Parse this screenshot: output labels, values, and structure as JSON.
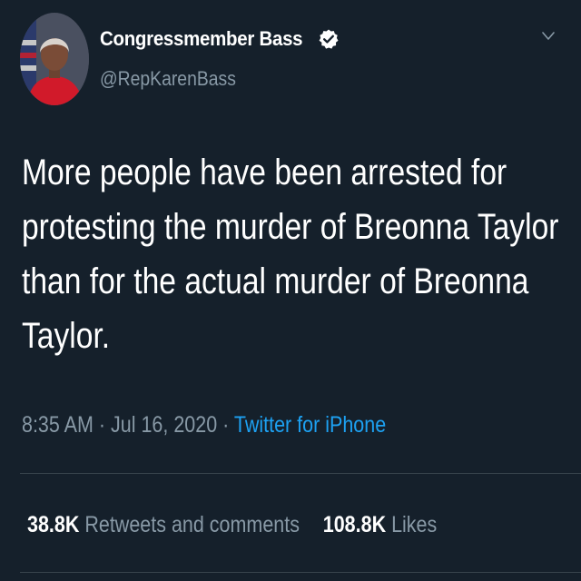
{
  "tweet": {
    "author": {
      "display_name": "Congressmember Bass",
      "handle": "@RepKarenBass",
      "verified": true,
      "avatar_icon": "profile-photo"
    },
    "text_lines": [
      "More people have been arrested for",
      "protesting the murder of Breonna Taylor",
      "than for the actual murder of Breonna",
      "Taylor."
    ],
    "meta": {
      "time": "8:35 AM",
      "separator": " · ",
      "date": "Jul 16, 2020",
      "source": "Twitter for iPhone"
    },
    "stats": {
      "retweets_count": "38.8K",
      "retweets_label": " Retweets and comments",
      "likes_count": "108.8K",
      "likes_label": " Likes"
    },
    "menu_icon": "chevron-down-icon"
  },
  "colors": {
    "background": "#15202b",
    "secondary_text": "#8899a6",
    "link": "#1da1f2",
    "divider": "#38444d",
    "verified_badge": "#ffffff"
  }
}
